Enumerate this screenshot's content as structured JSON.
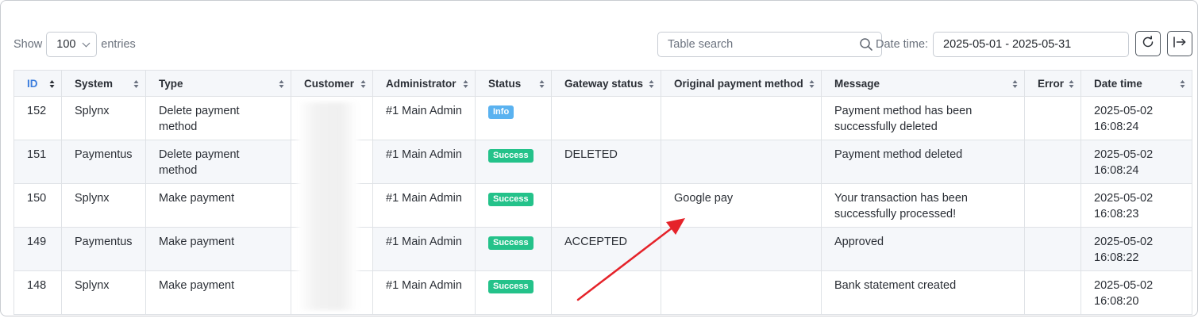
{
  "length_control": {
    "prefix": "Show",
    "value": "100",
    "suffix": "entries"
  },
  "search": {
    "placeholder": "Table search"
  },
  "date_filter": {
    "label": "Date time:",
    "value": "2025-05-01 - 2025-05-31"
  },
  "icons": {
    "search": "search-icon",
    "refresh": "refresh-icon",
    "export": "export-icon"
  },
  "columns": [
    "ID",
    "System",
    "Type",
    "Customer",
    "Administrator",
    "Status",
    "Gateway status",
    "Original payment method",
    "Message",
    "Error",
    "Date time"
  ],
  "rows": [
    {
      "id": "152",
      "system": "Splynx",
      "type": "Delete payment method",
      "customer": "",
      "admin": "#1 Main Admin",
      "status": "Info",
      "status_kind": "info",
      "gateway": "",
      "original": "",
      "message": "Payment method has been successfully deleted",
      "error": "",
      "datetime": "2025-05-02 16:08:24"
    },
    {
      "id": "151",
      "system": "Paymentus",
      "type": "Delete payment method",
      "customer": "",
      "admin": "#1 Main Admin",
      "status": "Success",
      "status_kind": "success",
      "gateway": "DELETED",
      "original": "",
      "message": "Payment method deleted",
      "error": "",
      "datetime": "2025-05-02 16:08:24"
    },
    {
      "id": "150",
      "system": "Splynx",
      "type": "Make payment",
      "customer": "",
      "admin": "#1 Main Admin",
      "status": "Success",
      "status_kind": "success",
      "gateway": "",
      "original": "Google pay",
      "message": "Your transaction has been successfully processed!",
      "error": "",
      "datetime": "2025-05-02 16:08:23"
    },
    {
      "id": "149",
      "system": "Paymentus",
      "type": "Make payment",
      "customer": "",
      "admin": "#1 Main Admin",
      "status": "Success",
      "status_kind": "success",
      "gateway": "ACCEPTED",
      "original": "",
      "message": "Approved",
      "error": "",
      "datetime": "2025-05-02 16:08:22"
    },
    {
      "id": "148",
      "system": "Splynx",
      "type": "Make payment",
      "customer": "",
      "admin": "#1 Main Admin",
      "status": "Success",
      "status_kind": "success",
      "gateway": "",
      "original": "",
      "message": "Bank statement created",
      "error": "",
      "datetime": "2025-05-02 16:08:20"
    }
  ],
  "colors": {
    "accent": "#3b7ddd",
    "info": "#5ab2f0",
    "success": "#24c28a",
    "annotation": "#e5232a"
  }
}
